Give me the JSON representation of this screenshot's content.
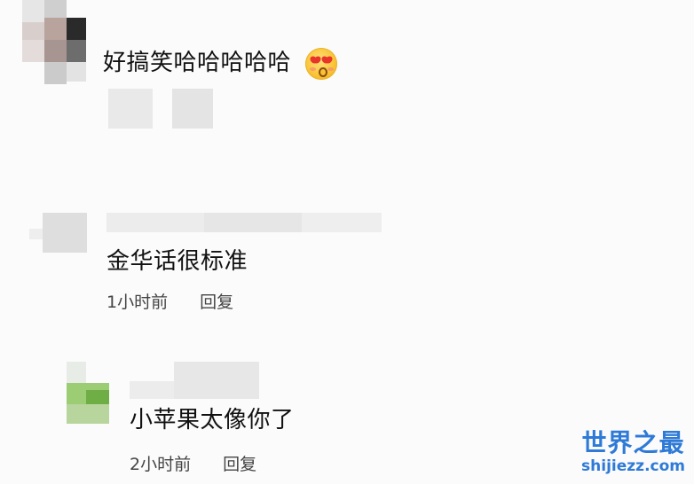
{
  "comments": [
    {
      "text": "好搞笑哈哈哈哈哈",
      "emoji": "heart-eyes-emoji"
    },
    {
      "text": "金华话很标准",
      "time": "1小时前",
      "reply": "回复"
    },
    {
      "text": "小苹果太像你了",
      "time": "2小时前",
      "reply": "回复"
    }
  ],
  "watermark": {
    "brand": "世界之最",
    "domain": "shijiezz.com",
    "color": "#2e7ad6"
  }
}
